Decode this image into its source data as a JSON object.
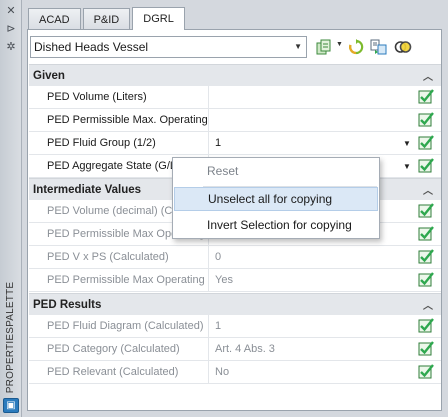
{
  "palette": {
    "title": "PROPERTIESPALETTE",
    "strip_icons": [
      "close-icon",
      "pin-icon",
      "settings-icon"
    ]
  },
  "tabs": [
    {
      "label": "ACAD",
      "active": false
    },
    {
      "label": "P&ID",
      "active": false
    },
    {
      "label": "DGRL",
      "active": true
    }
  ],
  "toolbar": {
    "selected_object": "Dished Heads Vessel",
    "icons": [
      "quick-select-icon",
      "refresh-icon",
      "copy-properties-icon",
      "toggle-icon"
    ]
  },
  "categories": [
    {
      "title": "Given",
      "rows": [
        {
          "name": "PED Volume (Liters)",
          "value": "",
          "readonly": false,
          "dropdown": false,
          "checked": true
        },
        {
          "name": "PED Permissible Max. Operating...",
          "value": "",
          "readonly": false,
          "dropdown": false,
          "checked": true
        },
        {
          "name": "PED Fluid Group (1/2)",
          "value": "1",
          "readonly": false,
          "dropdown": true,
          "checked": true
        },
        {
          "name": "PED Aggregate State (G/L)",
          "value": "",
          "readonly": false,
          "dropdown": true,
          "checked": true
        }
      ]
    },
    {
      "title": "Intermediate Values",
      "rows": [
        {
          "name": "PED Volume (decimal) (Calculated)",
          "value": "",
          "readonly": true,
          "dropdown": false,
          "checked": true
        },
        {
          "name": "PED Permissible Max Operating",
          "value": "",
          "readonly": true,
          "dropdown": false,
          "checked": true
        },
        {
          "name": "PED V x PS (Calculated)",
          "value": "0",
          "readonly": true,
          "dropdown": false,
          "checked": true
        },
        {
          "name": "PED Permissible Max Operating ...",
          "value": "Yes",
          "readonly": true,
          "dropdown": false,
          "checked": true
        }
      ]
    },
    {
      "title": "PED Results",
      "rows": [
        {
          "name": "PED Fluid Diagram (Calculated)",
          "value": "1",
          "readonly": true,
          "dropdown": false,
          "checked": true
        },
        {
          "name": "PED Category (Calculated)",
          "value": "Art. 4 Abs. 3",
          "readonly": true,
          "dropdown": false,
          "checked": true
        },
        {
          "name": "PED Relevant (Calculated)",
          "value": "No",
          "readonly": true,
          "dropdown": false,
          "checked": true
        }
      ]
    }
  ],
  "context_menu": [
    {
      "label": "Reset",
      "disabled": true,
      "hover": false
    },
    {
      "label": "Unselect all for copying",
      "disabled": false,
      "hover": true
    },
    {
      "label": "Invert Selection for copying",
      "disabled": false,
      "hover": false
    }
  ],
  "colors": {
    "check_green": "#2fa84f",
    "accent_blue": "#2b7bbd",
    "menu_hover": "#dbe8f6"
  }
}
